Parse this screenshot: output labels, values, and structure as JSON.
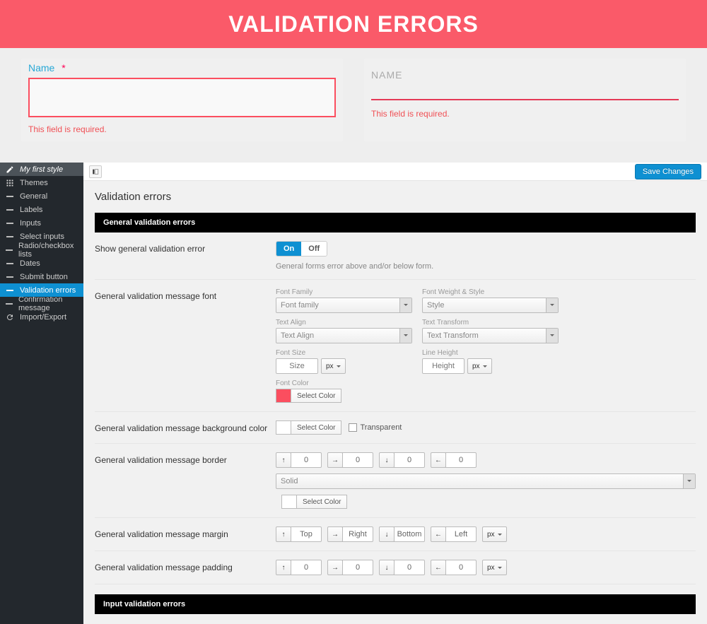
{
  "hero_title": "VALIDATION ERRORS",
  "preview": {
    "card1": {
      "label": "Name",
      "required_mark": "*",
      "error": "This field is required."
    },
    "card2": {
      "label": "NAME",
      "error": "This field is required."
    }
  },
  "sidebar": {
    "title": "My first style",
    "items": [
      {
        "label": "Themes",
        "icon": "grid"
      },
      {
        "label": "General",
        "icon": "minus"
      },
      {
        "label": "Labels",
        "icon": "minus"
      },
      {
        "label": "Inputs",
        "icon": "minus"
      },
      {
        "label": "Select inputs",
        "icon": "minus"
      },
      {
        "label": "Radio/checkbox lists",
        "icon": "minus"
      },
      {
        "label": "Dates",
        "icon": "minus"
      },
      {
        "label": "Submit button",
        "icon": "minus"
      },
      {
        "label": "Validation errors",
        "icon": "minus",
        "active": true
      },
      {
        "label": "Confirmation message",
        "icon": "minus"
      },
      {
        "label": "Import/Export",
        "icon": "reload"
      }
    ]
  },
  "toolbar": {
    "save_label": "Save Changes"
  },
  "page_title": "Validation errors",
  "sections": {
    "general": "General validation errors",
    "input": "Input validation errors"
  },
  "rows": {
    "show_general": {
      "label": "Show general validation error",
      "on": "On",
      "off": "Off",
      "hint": "General forms error above and/or below form."
    },
    "font": {
      "label": "General validation message font",
      "font_family": {
        "mini": "Font Family",
        "placeholder": "Font family"
      },
      "font_weight": {
        "mini": "Font Weight & Style",
        "placeholder": "Style"
      },
      "text_align": {
        "mini": "Text Align",
        "placeholder": "Text Align"
      },
      "text_transform": {
        "mini": "Text Transform",
        "placeholder": "Text Transform"
      },
      "font_size": {
        "mini": "Font Size",
        "placeholder": "Size",
        "unit": "px"
      },
      "line_height": {
        "mini": "Line Height",
        "placeholder": "Height",
        "unit": "px"
      },
      "font_color": {
        "mini": "Font Color",
        "btn": "Select Color",
        "value": "#fb4e5f"
      }
    },
    "bg": {
      "label": "General validation message background color",
      "btn": "Select Color",
      "transparent": "Transparent"
    },
    "border": {
      "label": "General validation message border",
      "values": [
        "0",
        "0",
        "0",
        "0"
      ],
      "style": "Solid",
      "select_color": "Select Color"
    },
    "margin": {
      "label": "General validation message margin",
      "values": [
        "Top",
        "Right",
        "Bottom",
        "Left"
      ],
      "unit": "px"
    },
    "padding": {
      "label": "General validation message padding",
      "values": [
        "0",
        "0",
        "0",
        "0"
      ],
      "unit": "px"
    }
  }
}
